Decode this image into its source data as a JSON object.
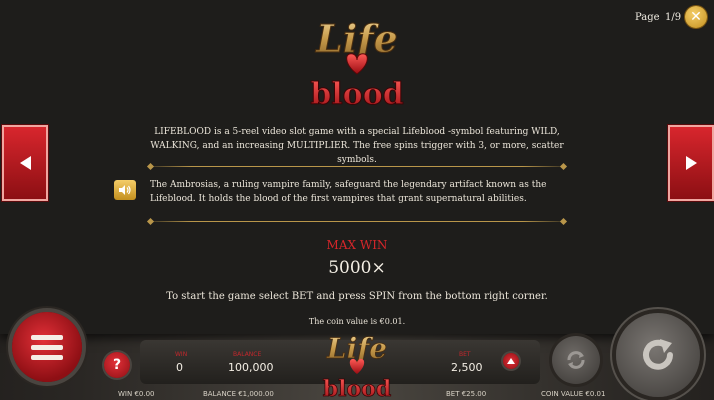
{
  "pager": {
    "label": "Page",
    "current": "1/9"
  },
  "close": {
    "glyph": "✕"
  },
  "logo": {
    "line1": "Life",
    "line2": "blood"
  },
  "intro_text": "LIFEBLOOD is a 5-reel video slot game with a special Lifeblood -symbol featuring WILD, WALKING, and an increasing MULTIPLIER. The free spins trigger with 3, or more, scatter symbols.",
  "story_text": "The Ambrosias, a ruling vampire family, safeguard the legendary artifact known as the Lifeblood. It holds the blood of the first vampires that grant supernatural abilities.",
  "max_win": {
    "label": "MAX WIN",
    "value": "5000×"
  },
  "instruction": "To start the game select BET and press SPIN from the bottom right corner.",
  "coin_note": "The coin value is €0.01.",
  "hud": {
    "win_label": "WIN",
    "win_value": "0",
    "balance_label": "BALANCE",
    "balance_value": "100,000",
    "bet_label": "BET",
    "bet_value": "2,500",
    "help_glyph": "?"
  },
  "footer": {
    "win": "WIN €0.00",
    "balance": "BALANCE €1,000.00",
    "bet": "BET €25.00",
    "coin": "COIN VALUE €0.01"
  },
  "colors": {
    "accent_red": "#d6262a",
    "gold": "#b9964a",
    "panel": "#1e1d1b"
  }
}
